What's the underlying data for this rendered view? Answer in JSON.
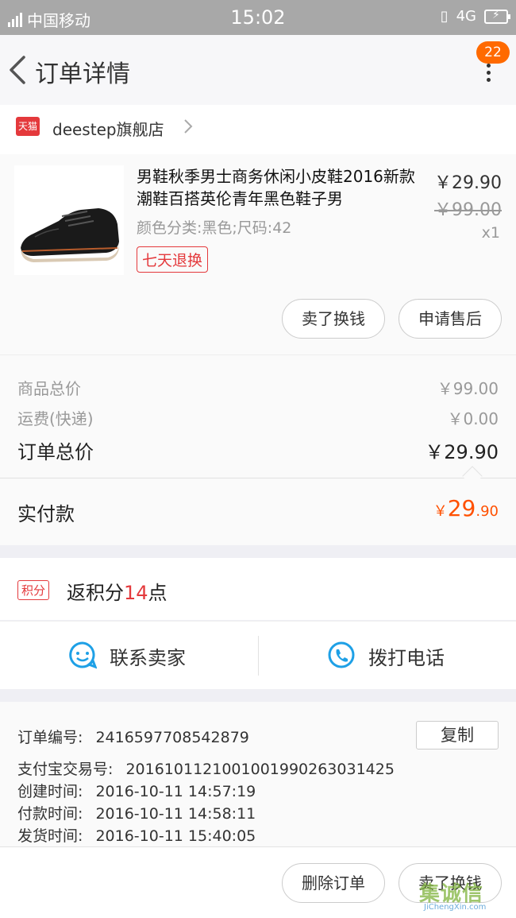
{
  "status": {
    "carrier": "中国移动",
    "time": "15:02",
    "network": "4G",
    "signal_label": "4G"
  },
  "header": {
    "title": "订单详情",
    "badge_count": "22"
  },
  "shop": {
    "platform_badge": "天猫",
    "name": "deestep旗舰店"
  },
  "product": {
    "name": "男鞋秋季男士商务休闲小皮鞋2016新款潮鞋百搭英伦青年黑色鞋子男",
    "spec": "颜色分类:黑色;尺码:42",
    "tag": "七天退换",
    "price": "￥29.90",
    "original_price": "￥99.00",
    "quantity": "x1",
    "actions": [
      "卖了换钱",
      "申请售后"
    ]
  },
  "summary": {
    "goods_label": "商品总价",
    "goods_value": "￥99.00",
    "shipping_label": "运费(快递)",
    "shipping_value": "￥0.00",
    "total_label": "订单总价",
    "total_value": "￥29.90",
    "paid_label": "实付款",
    "paid_currency": "￥",
    "paid_int": "29",
    "paid_dec": ".90"
  },
  "points": {
    "badge": "积分",
    "prefix": "返积分",
    "count": "14",
    "suffix": "点"
  },
  "contact": {
    "seller": "联系卖家",
    "call": "拨打电话"
  },
  "order_info": {
    "order_no_label": "订单编号:",
    "order_no": "2416597708542879",
    "alipay_label": "支付宝交易号:",
    "alipay_no": "2016101121001001990263031425",
    "created_label": "创建时间:",
    "created": "2016-10-11 14:57:19",
    "paid_label": "付款时间:",
    "paid": "2016-10-11 14:58:11",
    "shipped_label": "发货时间:",
    "shipped": "2016-10-11 15:40:05",
    "copy_label": "复制"
  },
  "bottom": {
    "delete": "删除订单",
    "sell": "卖了换钱"
  },
  "watermark": {
    "main": "集诚信",
    "sub": "JiChengXin.com"
  },
  "colors": {
    "accent": "#ff5000",
    "tmall_red": "#e4393c",
    "badge_orange": "#ff6a00",
    "contact_blue": "#1ea0e6"
  }
}
